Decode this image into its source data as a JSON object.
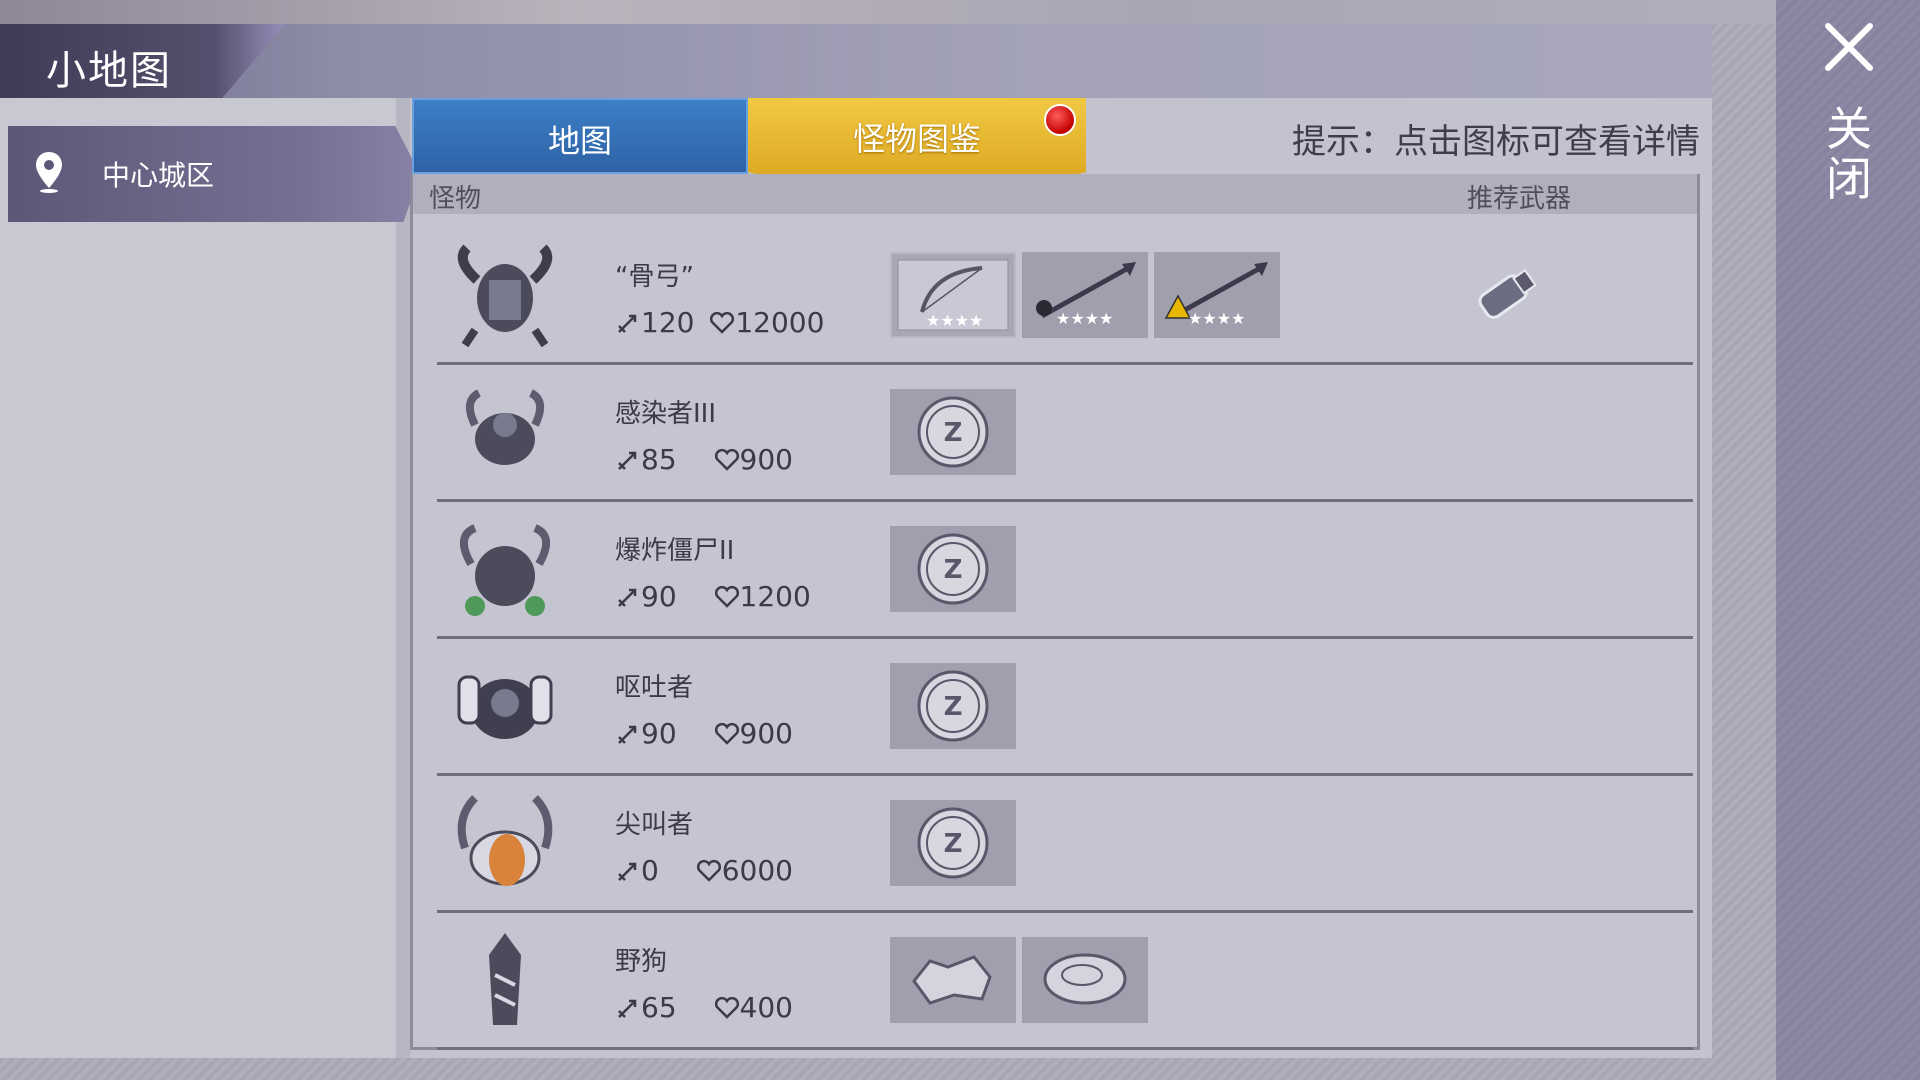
{
  "title": "小地图",
  "sidebar": {
    "items": [
      {
        "label": "中心城区"
      }
    ]
  },
  "tabs": {
    "map": "地图",
    "monsters": "怪物图鉴"
  },
  "hint": "提示：点击图标可查看详情",
  "table": {
    "col_monster": "怪物",
    "col_weapon": "推荐武器"
  },
  "monsters": [
    {
      "name": "“骨弓”",
      "attack": "120",
      "hp": "12000",
      "drops": [
        "bow-blueprint-4star",
        "skull-spear-4star",
        "fire-spear-4star"
      ],
      "recommended": "vial-icon"
    },
    {
      "name": "感染者III",
      "attack": "85",
      "hp": "900",
      "drops": [
        "z-coin"
      ]
    },
    {
      "name": "爆炸僵尸II",
      "attack": "90",
      "hp": "1200",
      "drops": [
        "z-coin"
      ]
    },
    {
      "name": "呕吐者",
      "attack": "90",
      "hp": "900",
      "drops": [
        "z-coin"
      ]
    },
    {
      "name": "尖叫者",
      "attack": "0",
      "hp": "6000",
      "drops": [
        "z-coin"
      ]
    },
    {
      "name": "野狗",
      "attack": "65",
      "hp": "400",
      "drops": [
        "animal-hide",
        "raw-meat"
      ]
    }
  ],
  "close": {
    "label": "关闭"
  },
  "colors": {
    "tab_map": "#2e62a6",
    "tab_active": "#e0aa22",
    "panel": "#c3c3cf"
  }
}
